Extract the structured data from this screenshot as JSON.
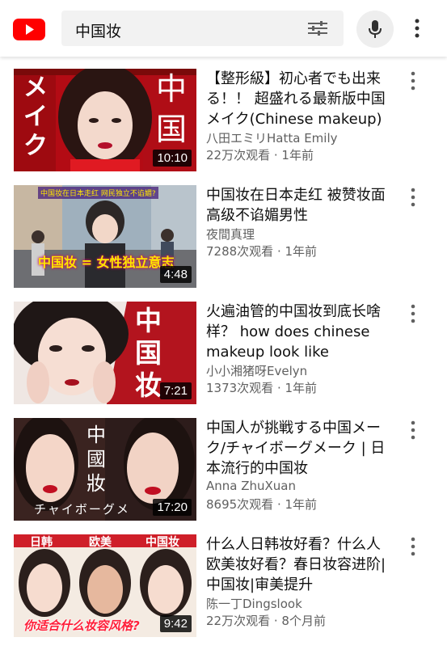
{
  "search": {
    "query": "中国妆"
  },
  "colors": {
    "brand": "#ff0000",
    "secondary_text": "#606060"
  },
  "icons": {
    "logo": "youtube-logo-icon",
    "filter": "filter-sliders-icon",
    "mic": "microphone-icon",
    "more": "more-vert-icon"
  },
  "videos": [
    {
      "title": "【整形級】初心者でも出来る！！ 超盛れる最新版中国メイク(Chinese makeup)",
      "channel": "八田エミリHatta Emily",
      "views": "22万次观看",
      "age": "1年前",
      "duration": "10:10",
      "thumb_text_left": "メイク",
      "thumb_text_right": "中国"
    },
    {
      "title": "中国妆在日本走红 被赞妆面高级不谄媚男性",
      "channel": "夜間真理",
      "views": "7288次观看",
      "age": "1年前",
      "duration": "4:48",
      "thumb_caption_top": "中国妆在日本走红 网民独立不谄媚?",
      "thumb_caption": "中国妆 = 女性独立意志"
    },
    {
      "title": "火遍油管的中国妆到底长啥样？ how does chinese makeup look like",
      "channel": "小小湘猪呀Evelyn",
      "views": "1373次观看",
      "age": "1年前",
      "duration": "7:21",
      "thumb_text_right": "中国妆"
    },
    {
      "title": "中国人が挑戦する中国メーク/チャイボーグメーク | 日本流行的中国妆",
      "channel": "Anna ZhuXuan",
      "views": "8695次观看",
      "age": "1年前",
      "duration": "17:20",
      "thumb_text_center": "中國妝",
      "thumb_caption": "チャイボーグメ"
    },
    {
      "title": "什么人日韩妆好看？什么人欧美妆好看？春日妆容进阶|中国妆|审美提升",
      "channel": "陈一丁Dingslook",
      "views": "22万次观看",
      "age": "8个月前",
      "duration": "9:42",
      "thumb_labels": [
        "日韩",
        "欧美",
        "中国妆"
      ],
      "thumb_caption": "你适合什么妆容风格?"
    }
  ],
  "meta_separator": " · "
}
